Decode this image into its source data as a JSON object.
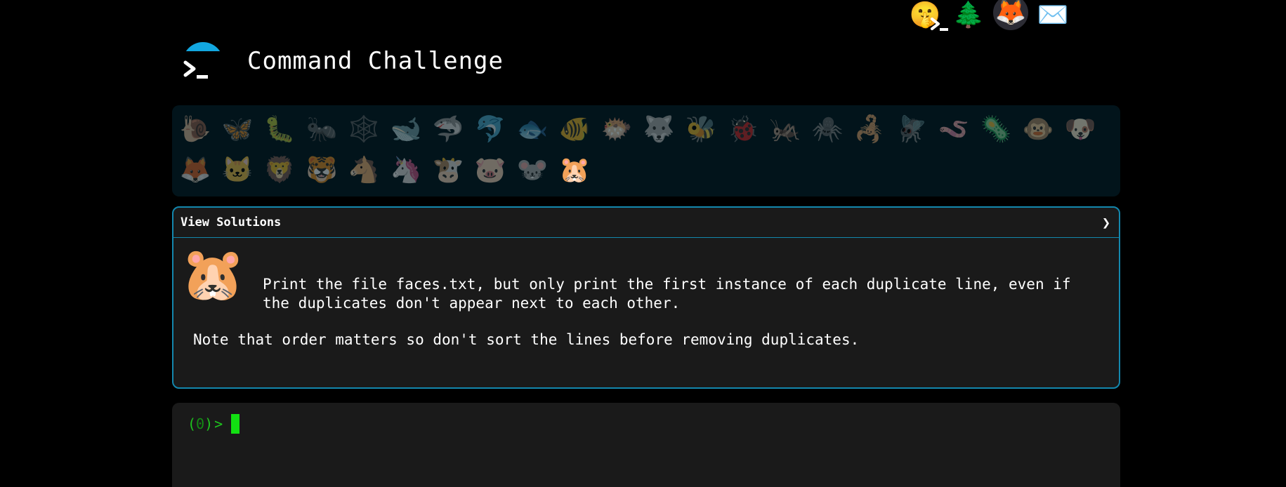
{
  "app": {
    "title": "Command Challenge"
  },
  "topbar": {
    "icons": [
      {
        "name": "terminal-prompt-icon",
        "glyph": ""
      },
      {
        "name": "shushing-face-icon",
        "glyph": "🤫"
      },
      {
        "name": "tree-icon",
        "glyph": "🌲"
      },
      {
        "name": "gitlab-icon",
        "glyph": "🦊"
      },
      {
        "name": "mail-icon",
        "glyph": "✉️"
      }
    ]
  },
  "animals": [
    {
      "name": "snail",
      "glyph": "🐌"
    },
    {
      "name": "butterfly",
      "glyph": "🦋"
    },
    {
      "name": "caterpillar",
      "glyph": "🐛"
    },
    {
      "name": "ant",
      "glyph": "🐜"
    },
    {
      "name": "spider-web",
      "glyph": "🕸️"
    },
    {
      "name": "whale",
      "glyph": "🐋"
    },
    {
      "name": "shark",
      "glyph": "🦈"
    },
    {
      "name": "dolphin",
      "glyph": "🐬"
    },
    {
      "name": "fish",
      "glyph": "🐟"
    },
    {
      "name": "tropical-fish",
      "glyph": "🐠"
    },
    {
      "name": "blowfish",
      "glyph": "🐡"
    },
    {
      "name": "wolf",
      "glyph": "🐺"
    },
    {
      "name": "bee",
      "glyph": "🐝"
    },
    {
      "name": "ladybug",
      "glyph": "🐞"
    },
    {
      "name": "cricket",
      "glyph": "🦗"
    },
    {
      "name": "spider",
      "glyph": "🕷️"
    },
    {
      "name": "scorpion",
      "glyph": "🦂"
    },
    {
      "name": "fly",
      "glyph": "🪰"
    },
    {
      "name": "worm",
      "glyph": "🪱"
    },
    {
      "name": "microbe",
      "glyph": "🦠"
    },
    {
      "name": "monkey",
      "glyph": "🐵"
    },
    {
      "name": "dog",
      "glyph": "🐶"
    },
    {
      "name": "fox",
      "glyph": "🦊"
    },
    {
      "name": "cat",
      "glyph": "🐱"
    },
    {
      "name": "lion",
      "glyph": "🦁"
    },
    {
      "name": "tiger",
      "glyph": "🐯"
    },
    {
      "name": "horse",
      "glyph": "🐴"
    },
    {
      "name": "unicorn",
      "glyph": "🦄"
    },
    {
      "name": "cow",
      "glyph": "🐮"
    },
    {
      "name": "pig",
      "glyph": "🐷"
    },
    {
      "name": "mouse",
      "glyph": "🐭"
    },
    {
      "name": "hamster",
      "glyph": "🐹",
      "current": true
    }
  ],
  "challenge": {
    "view_solutions_label": "View Solutions",
    "chevron": "❯",
    "mascot_glyph": "🐹",
    "description": "Print the file faces.txt, but only print the first instance of each duplicate line, even if the duplicates don't appear next to each other.",
    "note": "Note that order matters so don't sort the lines before removing duplicates."
  },
  "terminal": {
    "prompt_open": "(",
    "exit_code": "0",
    "prompt_close": ")",
    "prompt_symbol": ">"
  },
  "colors": {
    "accent": "#1387ad",
    "logo_arc": "#12a7e0",
    "prompt_green": "#1ec41e",
    "cursor_green": "#12e012",
    "panel_bg": "#1a1a1a",
    "animals_bg": "#02141b"
  }
}
